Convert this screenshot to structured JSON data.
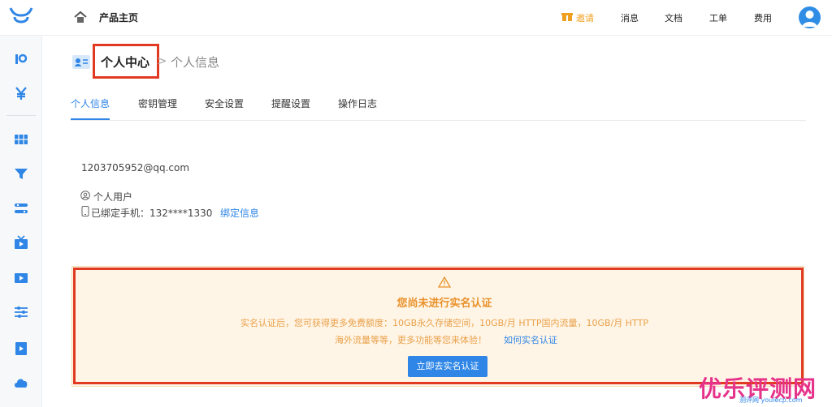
{
  "header": {
    "product_home": "产品主页",
    "invite": "邀请",
    "messages": "消息",
    "docs": "文档",
    "ticket": "工单",
    "fees": "费用"
  },
  "breadcrumb": {
    "current": "个人中心",
    "separator": ">",
    "sub": "个人信息"
  },
  "tabs": [
    {
      "label": "个人信息",
      "active": true
    },
    {
      "label": "密钥管理",
      "active": false
    },
    {
      "label": "安全设置",
      "active": false
    },
    {
      "label": "提醒设置",
      "active": false
    },
    {
      "label": "操作日志",
      "active": false
    }
  ],
  "profile": {
    "email": "1203705952@qq.com",
    "user_type": "个人用户",
    "phone_label": "已绑定手机：132****1330",
    "phone_link": "绑定信息"
  },
  "alert": {
    "title": "您尚未进行实名认证",
    "line1": "实名认证后，您可获得更多免费额度：10GB永久存储空间，10GB/月 HTTP国内流量，10GB/月 HTTP",
    "line2": "海外流量等等，更多功能等您来体验！",
    "link": "如何实名认证",
    "button": "立即去实名认证"
  },
  "watermark": {
    "text": "优乐评测网",
    "sub": "测评网 youlecp.com"
  },
  "colors": {
    "accent": "#2f86e6",
    "warning": "#e9912a",
    "highlight_box": "#e23a22",
    "invite": "#f0a020"
  }
}
